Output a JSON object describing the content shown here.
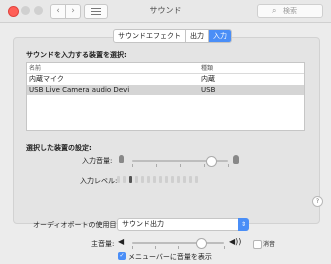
{
  "window": {
    "title": "サウンド",
    "search_placeholder": "検索"
  },
  "nav": {
    "back": "‹",
    "forward": "›"
  },
  "tabs": [
    {
      "label": "サウンドエフェクト",
      "active": false
    },
    {
      "label": "出力",
      "active": false
    },
    {
      "label": "入力",
      "active": true
    }
  ],
  "input": {
    "section_label": "サウンドを入力する装置を選択:",
    "columns": {
      "name": "名前",
      "type": "種類"
    },
    "devices": [
      {
        "name": "内蔵マイク",
        "type": "内蔵",
        "selected": false
      },
      {
        "name": "USB Live Camera audio Devi",
        "type": "USB",
        "selected": true
      }
    ],
    "settings_label": "選択した装置の設定:",
    "input_volume_label": "入力音量:",
    "input_level_label": "入力レベル:",
    "input_volume": 0.82,
    "input_level_on_segments": 1
  },
  "help": "?",
  "output_footer": {
    "alert_label": "オーディオポートの使用目的:",
    "alert_value": "サウンド出力",
    "volume_label": "主音量:",
    "volume": 0.75,
    "mute_label": "消音",
    "mute_checked": false,
    "menubar_label": "メニューバーに音量を表示",
    "menubar_checked": true
  },
  "colors": {
    "accent": "#4a8ef7",
    "close": "#ff5f57"
  }
}
